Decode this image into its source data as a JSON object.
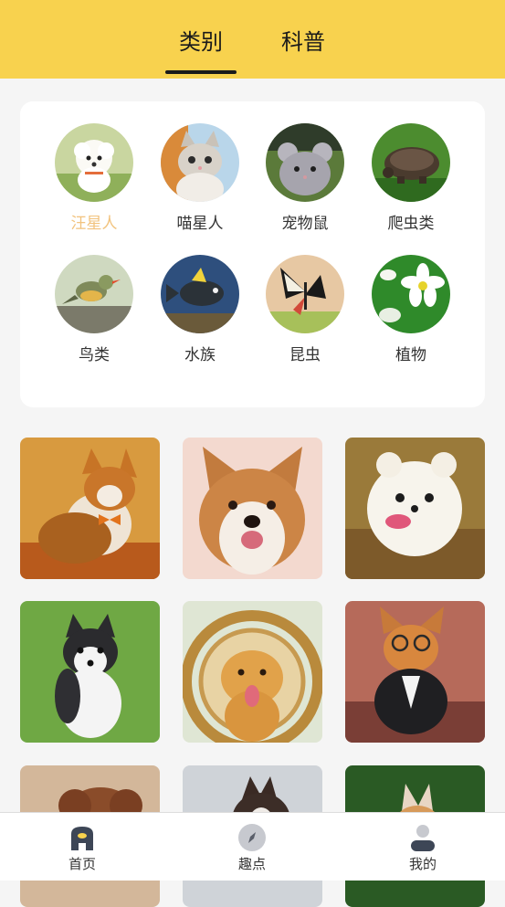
{
  "header": {
    "tabs": [
      {
        "label": "类别",
        "active": true
      },
      {
        "label": "科普",
        "active": false
      }
    ],
    "background_color": "#f8d24e"
  },
  "categories": [
    {
      "label": "汪星人",
      "active": true,
      "icon": "dog-photo"
    },
    {
      "label": "喵星人",
      "active": false,
      "icon": "cat-photo"
    },
    {
      "label": "宠物鼠",
      "active": false,
      "icon": "chinchilla-photo"
    },
    {
      "label": "爬虫类",
      "active": false,
      "icon": "turtle-photo"
    },
    {
      "label": "鸟类",
      "active": false,
      "icon": "bird-photo"
    },
    {
      "label": "水族",
      "active": false,
      "icon": "fish-photo"
    },
    {
      "label": "昆虫",
      "active": false,
      "icon": "butterfly-photo"
    },
    {
      "label": "植物",
      "active": false,
      "icon": "flower-photo"
    }
  ],
  "active_category_color": "#f2c37e",
  "photos": [
    {
      "subject": "corgi-with-bowtie"
    },
    {
      "subject": "smiling-corgi"
    },
    {
      "subject": "white-pomeranian"
    },
    {
      "subject": "husky-puppy"
    },
    {
      "subject": "golden-retriever"
    },
    {
      "subject": "corgi-with-glasses"
    },
    {
      "subject": "poodle"
    },
    {
      "subject": "alaskan-malamute"
    },
    {
      "subject": "shiba-dog"
    }
  ],
  "bottom_nav": [
    {
      "label": "首页",
      "icon": "home-icon",
      "active": true
    },
    {
      "label": "趣点",
      "icon": "compass-icon",
      "active": false
    },
    {
      "label": "我的",
      "icon": "user-icon",
      "active": false
    }
  ]
}
